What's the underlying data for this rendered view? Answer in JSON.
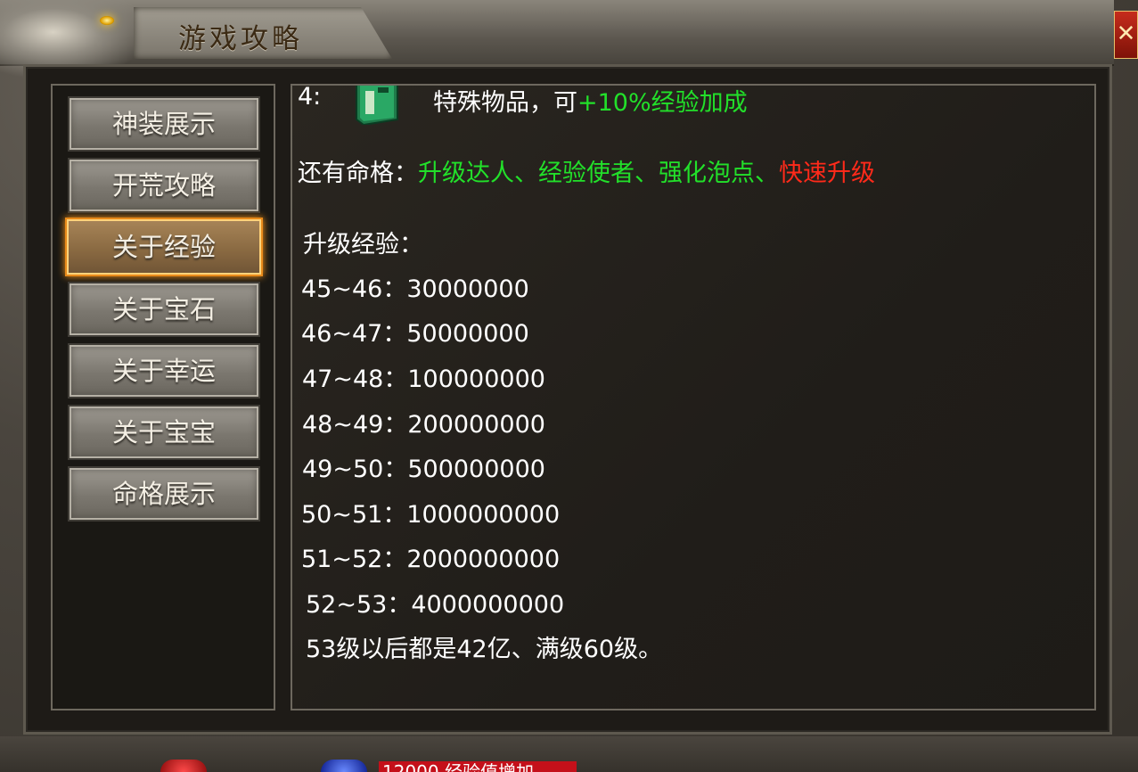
{
  "window": {
    "title": "游戏攻略",
    "close_label": "✕"
  },
  "menu": {
    "items": [
      {
        "label": "神装展示",
        "active": false
      },
      {
        "label": "开荒攻略",
        "active": false
      },
      {
        "label": "关于经验",
        "active": true
      },
      {
        "label": "关于宝石",
        "active": false
      },
      {
        "label": "关于幸运",
        "active": false
      },
      {
        "label": "关于宝宝",
        "active": false
      },
      {
        "label": "命格展示",
        "active": false
      }
    ]
  },
  "content": {
    "item4": {
      "index": "4:",
      "icon": "green-book-icon",
      "desc": "特殊物品，可",
      "bonus": "+10%经验加成"
    },
    "mingge": {
      "prefix": "还有命格：",
      "green_items": "升级达人、经验使者、强化泡点、",
      "red_item": "快速升级"
    },
    "levels_title": "升级经验：",
    "levels": [
      {
        "range": "45~46：",
        "exp": "30000000"
      },
      {
        "range": "46~47：",
        "exp": "50000000"
      },
      {
        "range": "47~48：",
        "exp": "100000000"
      },
      {
        "range": "48~49：",
        "exp": "200000000"
      },
      {
        "range": "49~50：",
        "exp": "500000000"
      },
      {
        "range": "50~51：",
        "exp": "1000000000"
      },
      {
        "range": "51~52：",
        "exp": "2000000000"
      },
      {
        "range": "52~53：",
        "exp": "4000000000"
      }
    ],
    "footer_note": "53级以后都是42亿、满级60级。"
  },
  "bottom": {
    "badge_text": "12000 经验值增加"
  },
  "colors": {
    "green": "#22e02a",
    "red": "#ff2a1a",
    "active_border": "#e88a1a"
  }
}
